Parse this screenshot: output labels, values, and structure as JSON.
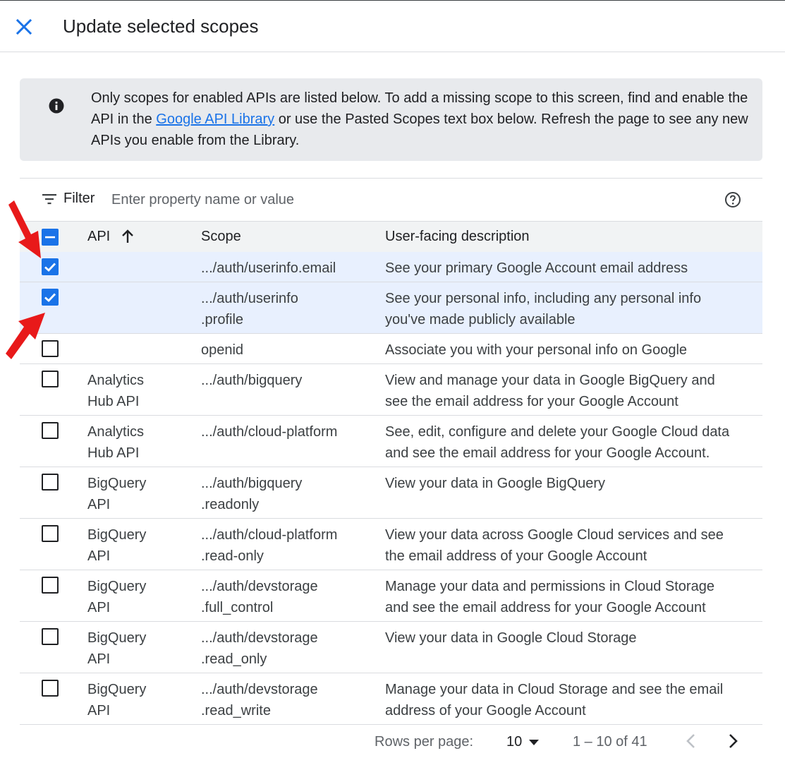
{
  "dialog": {
    "title": "Update selected scopes"
  },
  "info": {
    "text_before": "Only scopes for enabled APIs are listed below. To add a missing scope to this screen, find and enable the API in the ",
    "link": "Google API Library",
    "text_after": " or use the Pasted Scopes text box below. Refresh the page to see any new APIs you enable from the Library."
  },
  "filter": {
    "label": "Filter",
    "placeholder": "Enter property name or value"
  },
  "table": {
    "headers": {
      "api": "API",
      "scope": "Scope",
      "description": "User-facing description"
    },
    "rows": [
      {
        "checked": true,
        "api": [
          ""
        ],
        "scope": [
          ".../auth/userinfo.email"
        ],
        "description": [
          "See your primary Google Account email address"
        ]
      },
      {
        "checked": true,
        "api": [
          ""
        ],
        "scope": [
          ".../auth/userinfo",
          ".profile"
        ],
        "description": [
          "See your personal info, including any personal info",
          "you've made publicly available"
        ]
      },
      {
        "checked": false,
        "api": [
          ""
        ],
        "scope": [
          "openid"
        ],
        "description": [
          "Associate you with your personal info on Google"
        ]
      },
      {
        "checked": false,
        "api": [
          "Analytics",
          "Hub API"
        ],
        "scope": [
          ".../auth/bigquery"
        ],
        "description": [
          "View and manage your data in Google BigQuery and",
          "see the email address for your Google Account"
        ]
      },
      {
        "checked": false,
        "api": [
          "Analytics",
          "Hub API"
        ],
        "scope": [
          ".../auth/cloud-platform"
        ],
        "description": [
          "See, edit, configure and delete your Google Cloud data",
          "and see the email address for your Google Account."
        ]
      },
      {
        "checked": false,
        "api": [
          "BigQuery",
          "API"
        ],
        "scope": [
          ".../auth/bigquery",
          ".readonly"
        ],
        "description": [
          "View your data in Google BigQuery"
        ]
      },
      {
        "checked": false,
        "api": [
          "BigQuery",
          "API"
        ],
        "scope": [
          ".../auth/cloud-platform",
          ".read-only"
        ],
        "description": [
          "View your data across Google Cloud services and see",
          "the email address of your Google Account"
        ]
      },
      {
        "checked": false,
        "api": [
          "BigQuery",
          "API"
        ],
        "scope": [
          ".../auth/devstorage",
          ".full_control"
        ],
        "description": [
          "Manage your data and permissions in Cloud Storage",
          "and see the email address for your Google Account"
        ]
      },
      {
        "checked": false,
        "api": [
          "BigQuery",
          "API"
        ],
        "scope": [
          ".../auth/devstorage",
          ".read_only"
        ],
        "description": [
          "View your data in Google Cloud Storage"
        ]
      },
      {
        "checked": false,
        "api": [
          "BigQuery",
          "API"
        ],
        "scope": [
          ".../auth/devstorage",
          ".read_write"
        ],
        "description": [
          "Manage your data in Cloud Storage and see the email",
          "address of your Google Account"
        ]
      }
    ]
  },
  "pagination": {
    "rows_label": "Rows per page:",
    "rows_value": "10",
    "range": "1 – 10 of 41"
  },
  "colors": {
    "accent": "#1a73e8",
    "selected_row": "#e8f0fe",
    "annotation_arrow": "#e8191a"
  }
}
